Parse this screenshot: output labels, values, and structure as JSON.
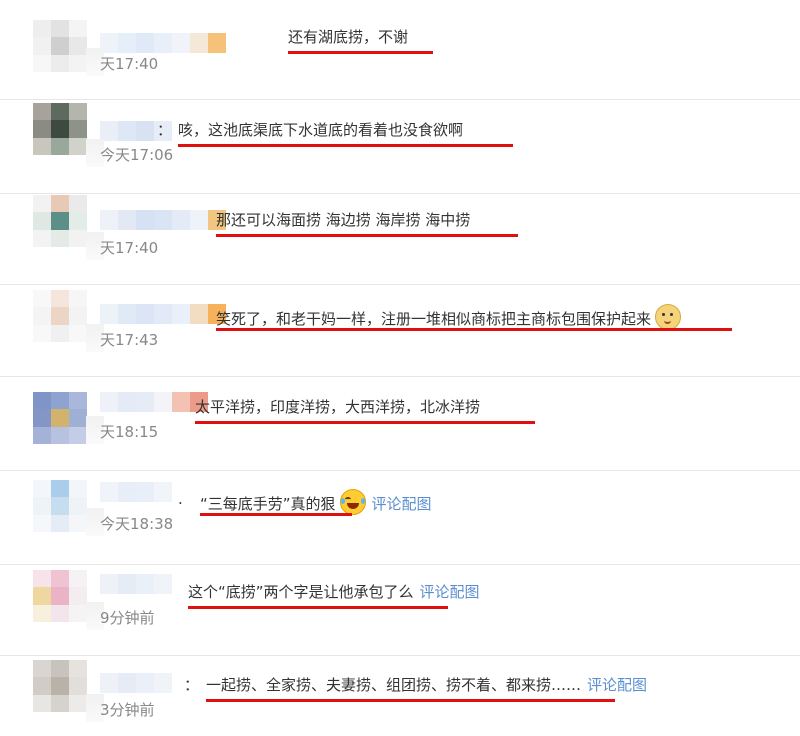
{
  "comments": [
    {
      "text": "还有湖底捞，不谢",
      "time": "天17:40",
      "prefix": "",
      "link": "",
      "emoji": ""
    },
    {
      "text": "咳，这池底渠底下水道底的看着也没食欲啊",
      "time": "今天17:06",
      "prefix": "：",
      "link": "",
      "emoji": ""
    },
    {
      "text": "那还可以海面捞 海边捞 海岸捞 海中捞",
      "time": "天17:40",
      "prefix": "",
      "link": "",
      "emoji": ""
    },
    {
      "text": "笑死了，和老干妈一样，注册一堆相似商标把主商标包围保护起来",
      "time": "天17:43",
      "prefix": "",
      "link": "",
      "emoji": "doge-icon"
    },
    {
      "text": "太平洋捞，印度洋捞，大西洋捞，北冰洋捞",
      "time": "天18:15",
      "prefix": "",
      "link": "",
      "emoji": ""
    },
    {
      "text": "“三每底手劳”真的狠",
      "time": "今天18:38",
      "prefix": ".",
      "link": "评论配图",
      "emoji": "laugh-cry-icon"
    },
    {
      "text": "这个“底捞”两个字是让他承包了么",
      "time": "9分钟前",
      "prefix": "",
      "link": "评论配图",
      "emoji": ""
    },
    {
      "text": "一起捞、全家捞、夫妻捞、组团捞、捞不着、都来捞……",
      "time": "3分钟前",
      "prefix": "：",
      "link": "评论配图",
      "emoji": ""
    }
  ],
  "colors": {
    "underline": "#e01010",
    "link": "#5b8fd0",
    "time": "#888888",
    "divider": "#e6e6e6"
  }
}
